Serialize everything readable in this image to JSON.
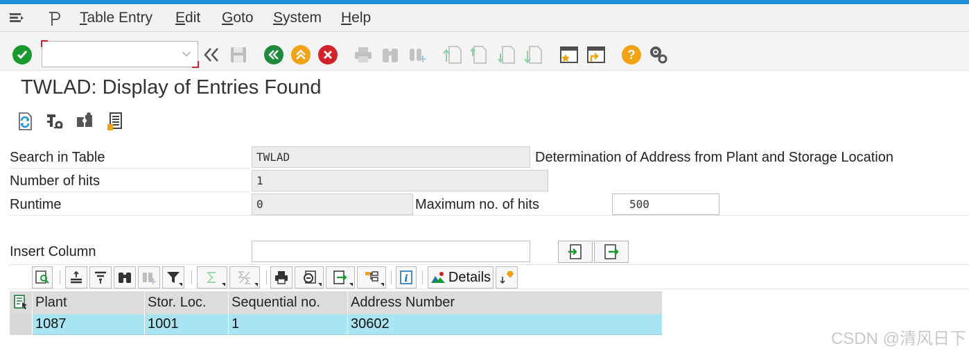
{
  "menu": {
    "items": [
      "Table Entry",
      "Edit",
      "Goto",
      "System",
      "Help"
    ]
  },
  "toolbar": {
    "command_value": ""
  },
  "page": {
    "title": "TWLAD: Display of Entries Found"
  },
  "form": {
    "search_in_table_label": "Search in Table",
    "search_in_table_value": "TWLAD",
    "table_description": "Determination of Address from Plant and Storage Location",
    "number_of_hits_label": "Number of hits",
    "number_of_hits_value": "1",
    "runtime_label": "Runtime",
    "runtime_value": "0",
    "max_hits_label": "Maximum no. of hits",
    "max_hits_value": "500",
    "insert_column_label": "Insert Column",
    "insert_column_value": ""
  },
  "alv": {
    "details_label": "Details"
  },
  "grid": {
    "columns": [
      "Plant",
      "Stor. Loc.",
      "Sequential no.",
      "Address Number"
    ],
    "rows": [
      [
        "1087",
        "1001",
        "1",
        "30602"
      ]
    ]
  },
  "watermark": "CSDN @清风日下",
  "colors": {
    "accent_bar": "#1c8fd6",
    "selected_row": "#a8e4f1",
    "enter_green": "#1a9a2e",
    "nav_green": "#1f8a3c",
    "exit_orange": "#f2a314",
    "cancel_red": "#d3222a",
    "help_orange": "#f2a314"
  }
}
